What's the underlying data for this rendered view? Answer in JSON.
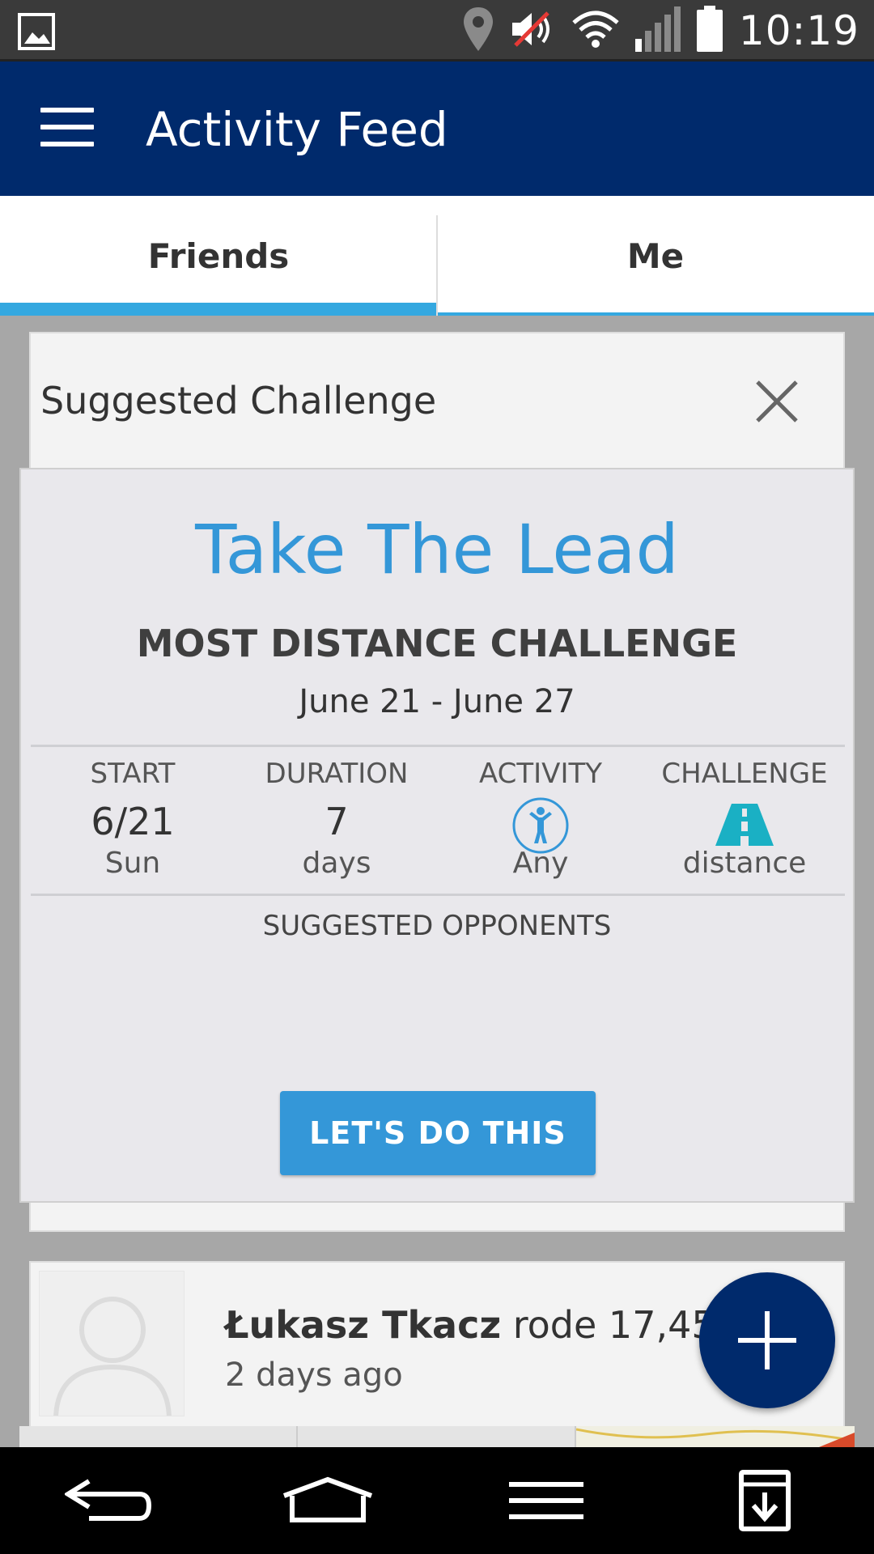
{
  "status_bar": {
    "time": "10:19",
    "icons": [
      "gallery-icon",
      "location-icon",
      "mute-icon",
      "wifi-icon",
      "signal-icon",
      "battery-icon"
    ]
  },
  "app_bar": {
    "title": "Activity Feed",
    "menu_icon": "hamburger-menu-icon"
  },
  "tabs": [
    {
      "label": "Friends",
      "active": true
    },
    {
      "label": "Me",
      "active": false
    }
  ],
  "suggested_challenge": {
    "header": "Suggested Challenge",
    "close_icon": "close-icon",
    "title": "Take The Lead",
    "subtitle": "MOST DISTANCE CHALLENGE",
    "dates": "June 21 - June 27",
    "stats": {
      "start": {
        "label": "START",
        "value": "6/21",
        "unit": "Sun"
      },
      "duration": {
        "label": "DURATION",
        "value": "7",
        "unit": "days"
      },
      "activity": {
        "label": "ACTIVITY",
        "icon": "person-activity-icon",
        "unit": "Any"
      },
      "challenge": {
        "label": "CHALLENGE",
        "icon": "road-icon",
        "unit": "distance"
      }
    },
    "opponents_label": "SUGGESTED OPPONENTS",
    "cta_label": "LET'S DO THIS"
  },
  "feed": [
    {
      "name": "Łukasz Tkacz",
      "action": "rode 17,45 km",
      "time": "2 days ago",
      "avatar_icon": "default-avatar-icon"
    }
  ],
  "fab": {
    "icon": "plus-icon"
  },
  "nav_bar": {
    "icons": [
      "back-icon",
      "home-icon",
      "recent-apps-icon",
      "download-icon"
    ]
  },
  "colors": {
    "app_bar": "#002a6c",
    "accent": "#3497d8",
    "tab_indicator": "#34a8e0",
    "road_icon": "#1ab0c4"
  }
}
